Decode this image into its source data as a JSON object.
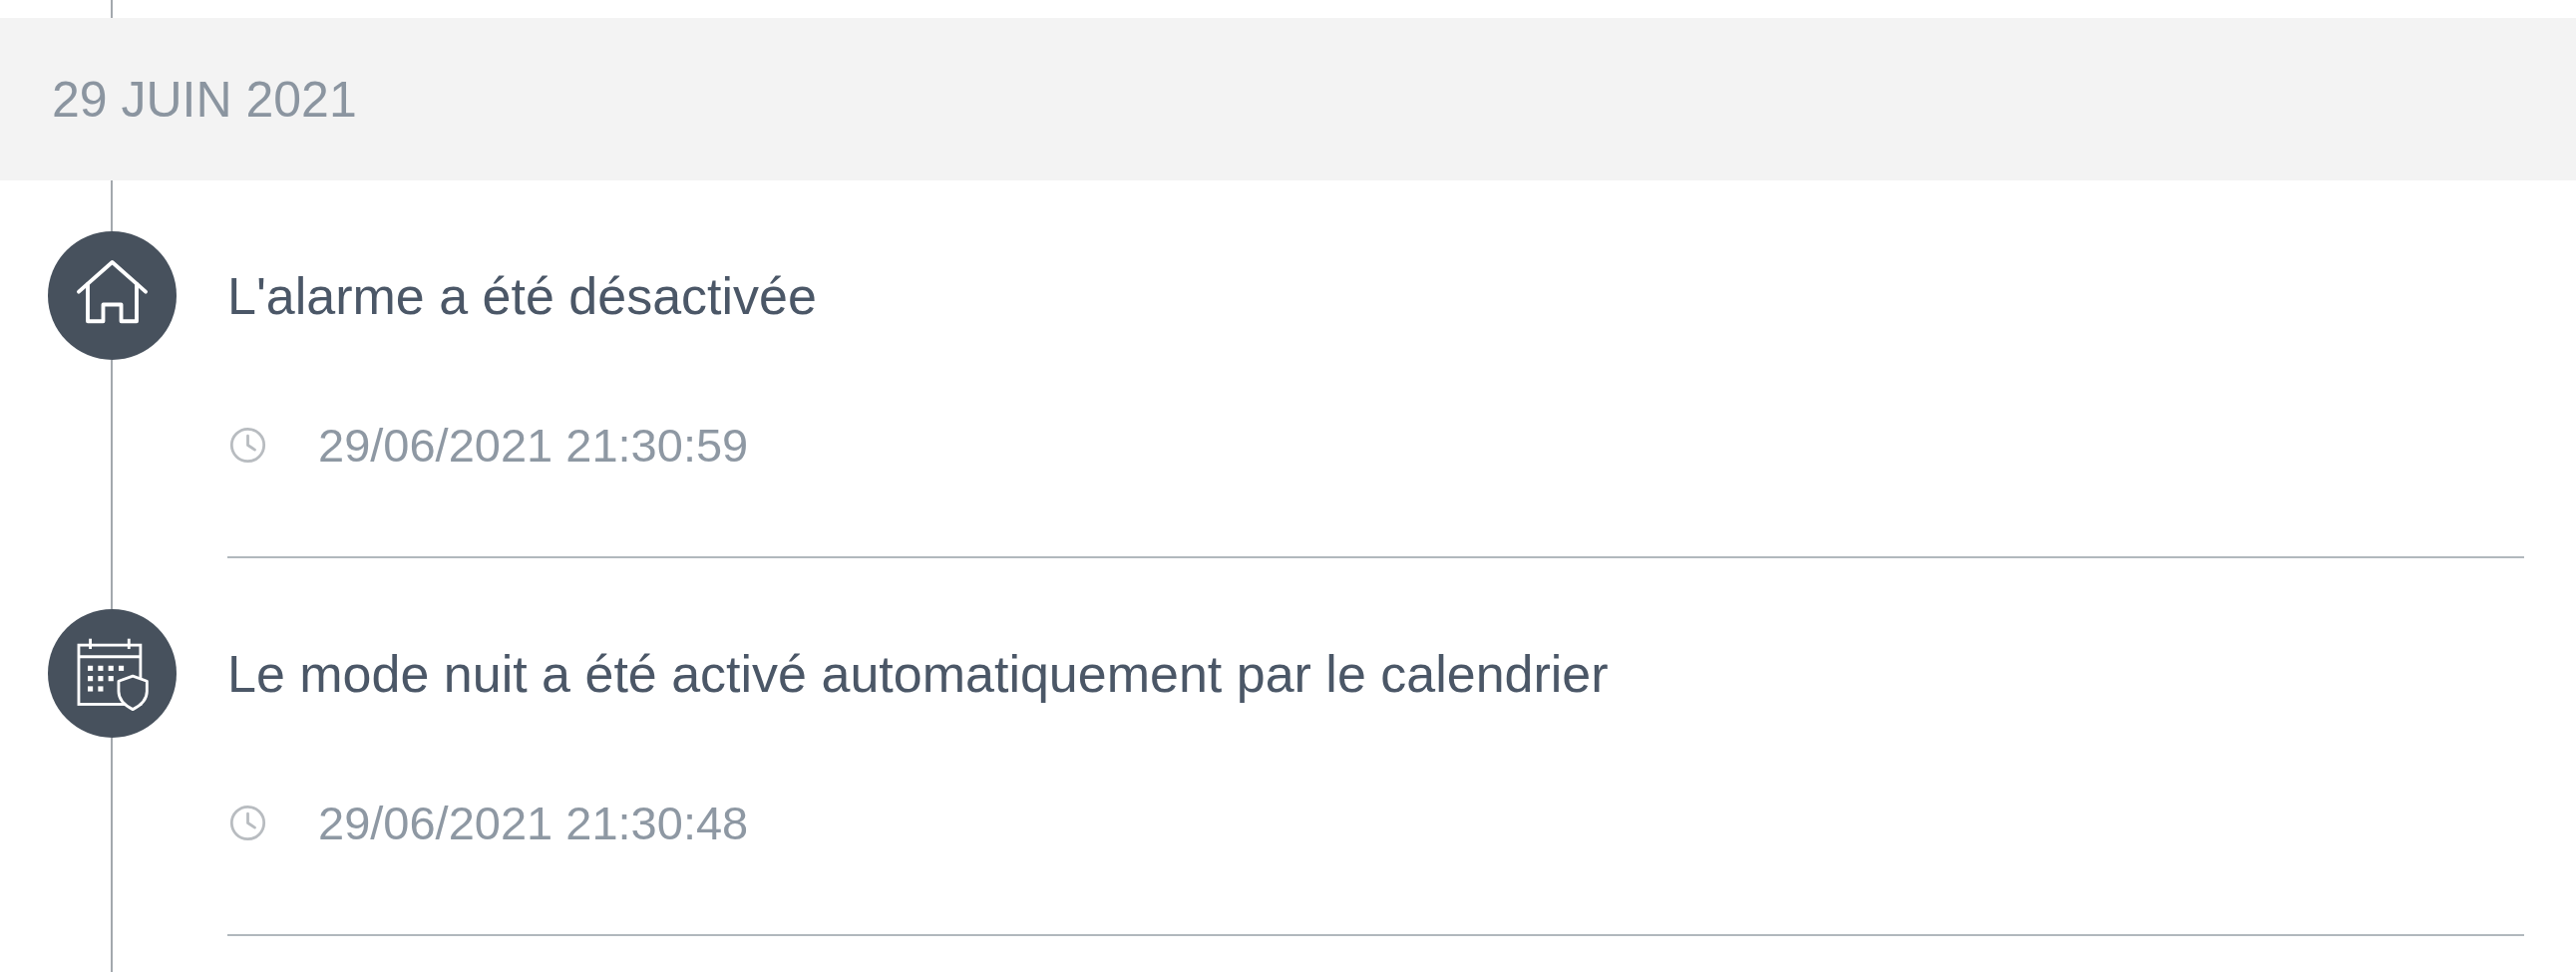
{
  "date_header": "29 JUIN 2021",
  "events": [
    {
      "kind": "alarm",
      "title": "L'alarme a été désactivée",
      "timestamp": "29/06/2021 21:30:59"
    },
    {
      "kind": "schedule",
      "title": "Le mode nuit a été activé automatiquement par le calendrier",
      "timestamp": "29/06/2021 21:30:48"
    }
  ]
}
